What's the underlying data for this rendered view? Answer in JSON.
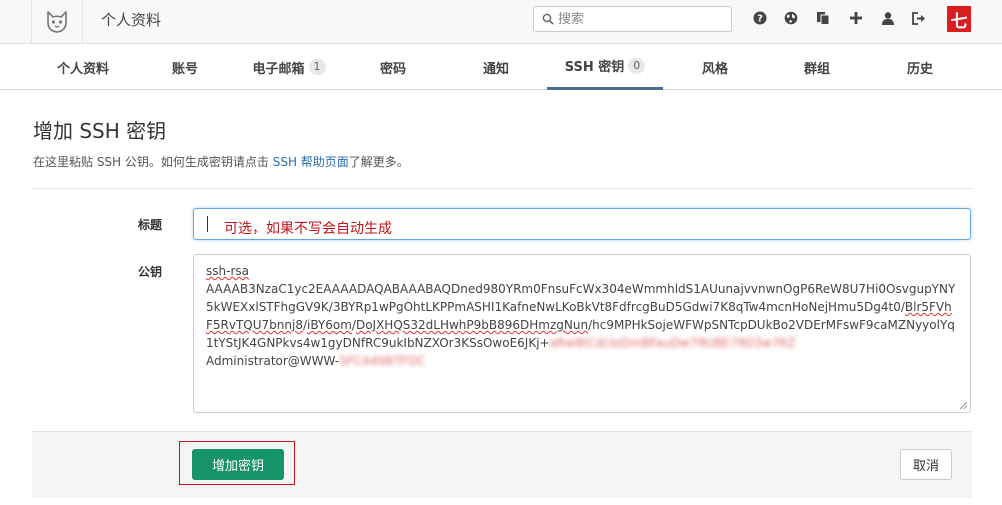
{
  "header": {
    "title": "个人资料",
    "search_placeholder": "搜索",
    "avatar_glyph": "七"
  },
  "tabs": [
    {
      "label": "个人资料",
      "badge": null
    },
    {
      "label": "账号",
      "badge": null
    },
    {
      "label": "电子邮箱",
      "badge": "1"
    },
    {
      "label": "密码",
      "badge": null
    },
    {
      "label": "通知",
      "badge": null
    },
    {
      "label": "SSH 密钥",
      "badge": "0"
    },
    {
      "label": "风格",
      "badge": null
    },
    {
      "label": "群组",
      "badge": null
    },
    {
      "label": "历史",
      "badge": null
    }
  ],
  "active_tab": 5,
  "page": {
    "heading": "增加 SSH 密钥",
    "hint_before": "在这里粘贴 SSH 公钥。如何生成密钥请点击 ",
    "hint_link": "SSH 帮助页面",
    "hint_after": "了解更多。"
  },
  "form": {
    "title_label": "标题",
    "title_note": "可选，如果不写会自动生成",
    "key_label": "公钥",
    "key_line1": "ssh-rsa",
    "key_part1": "AAAAB3NzaC1yc2EAAAADAQABAAABAQDned980YRm0FnsuFcWx304eWmmhldS1AUunajvvnwnOgP6ReW8U7Hi0OsvgupYNY5kWEXxlSTFhgGV9K/3BYRp1wPgOhtLKPPmASHI1KafneNwLKoBkVt8FdfrcgBuD5Gdwi7K8qTw4mcnHoNejHmu5Dg4t0/",
    "key_part2": "Blr5FVhF5RvTQU7bnnj8",
    "key_part3": "/",
    "key_part4": "iBY6om",
    "key_part5": "/",
    "key_part6": "DoJXHQS32dLHwhP9bB896DHmzgNun",
    "key_part7": "/hc9MPHkSojeWFWpSNTcpDUkBo2VDErMFswF9caMZNyyolYq1tYStJK4GNPkvs4w1gyDNfRC9ukIbNZXOr3KSsOwoE6JKj+",
    "key_blur1": "aRw8tCdcIoDmBFauDw79UBE79D3w7KZ",
    "key_line_last": "Administrator@WWW-",
    "key_blur2": "5FCA4987FDC"
  },
  "actions": {
    "submit_label": "增加密钥",
    "cancel_label": "取消"
  },
  "colors": {
    "primary": "#17936a",
    "active_tab": "#4a6e94",
    "note_red": "#c0161b",
    "link": "#2b6cb0"
  }
}
